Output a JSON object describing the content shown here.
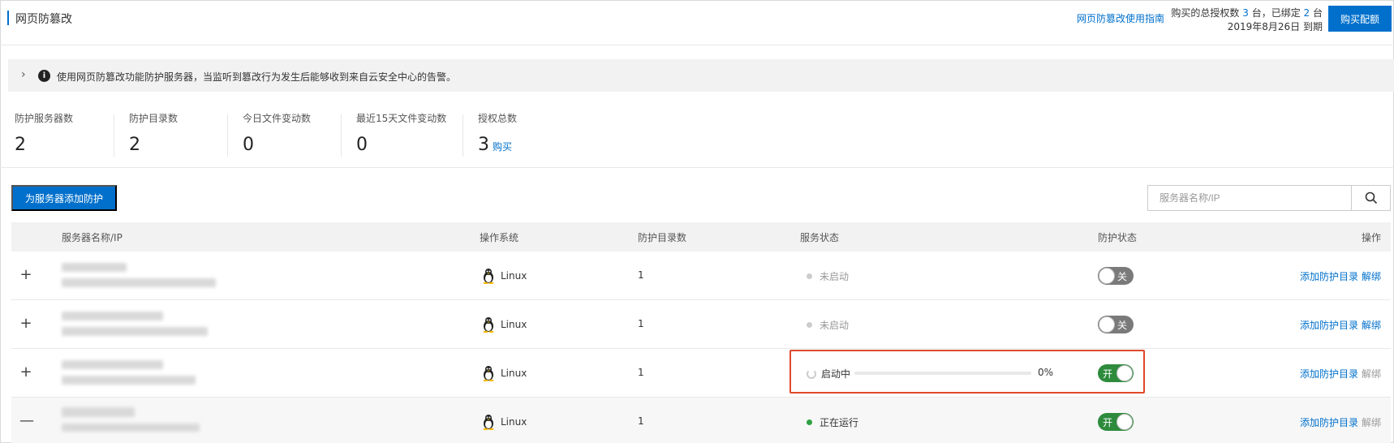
{
  "header": {
    "title": "网页防篡改",
    "guide_link": "网页防篡改使用指南",
    "license_line1_pre": "购买的总授权数 ",
    "license_total": "3",
    "license_line1_mid": " 台，已绑定 ",
    "license_bound": "2",
    "license_line1_post": " 台",
    "license_expiry": "2019年8月26日 到期",
    "buy_quota_label": "购买配额"
  },
  "notice": {
    "chevron": "›",
    "info_glyph": "i",
    "text": "使用网页防篡改功能防护服务器，当监听到篡改行为发生后能够收到来自云安全中心的告警。"
  },
  "stats": [
    {
      "label": "防护服务器数",
      "value": "2"
    },
    {
      "label": "防护目录数",
      "value": "2"
    },
    {
      "label": "今日文件变动数",
      "value": "0"
    },
    {
      "label": "最近15天文件变动数",
      "value": "0"
    },
    {
      "label": "授权总数",
      "value": "3",
      "link": "购买"
    }
  ],
  "toolbar": {
    "add_protection_label": "为服务器添加防护",
    "search_placeholder": "服务器名称/IP"
  },
  "table": {
    "headers": {
      "server": "服务器名称/IP",
      "os": "操作系统",
      "dirs": "防护目录数",
      "service": "服务状态",
      "protection": "防护状态",
      "actions": "操作"
    },
    "rows": [
      {
        "expander": "+",
        "os": "Linux",
        "dirs": "1",
        "service_status": "未启动",
        "protection_label": "关",
        "protection_on": false,
        "action_add": "添加防护目录",
        "action_unbind": "解绑"
      },
      {
        "expander": "+",
        "os": "Linux",
        "dirs": "1",
        "service_status": "未启动",
        "protection_label": "关",
        "protection_on": false,
        "action_add": "添加防护目录",
        "action_unbind": "解绑"
      },
      {
        "expander": "+",
        "os": "Linux",
        "dirs": "1",
        "service_status": "启动中",
        "progress": "0%",
        "protection_label": "开",
        "protection_on": true,
        "action_add": "添加防护目录",
        "action_unbind": "解绑"
      },
      {
        "expander": "—",
        "os": "Linux",
        "dirs": "1",
        "service_status": "正在运行",
        "protection_label": "开",
        "protection_on": true,
        "action_add": "添加防护目录",
        "action_unbind": "解绑"
      }
    ]
  },
  "colors": {
    "accent": "#0070cc",
    "toggle_on": "#2e8b3d",
    "toggle_off": "#7a7a7a",
    "running_dot": "#2ea043",
    "stopped_dot": "#cccccc",
    "highlight": "#e0492b"
  }
}
